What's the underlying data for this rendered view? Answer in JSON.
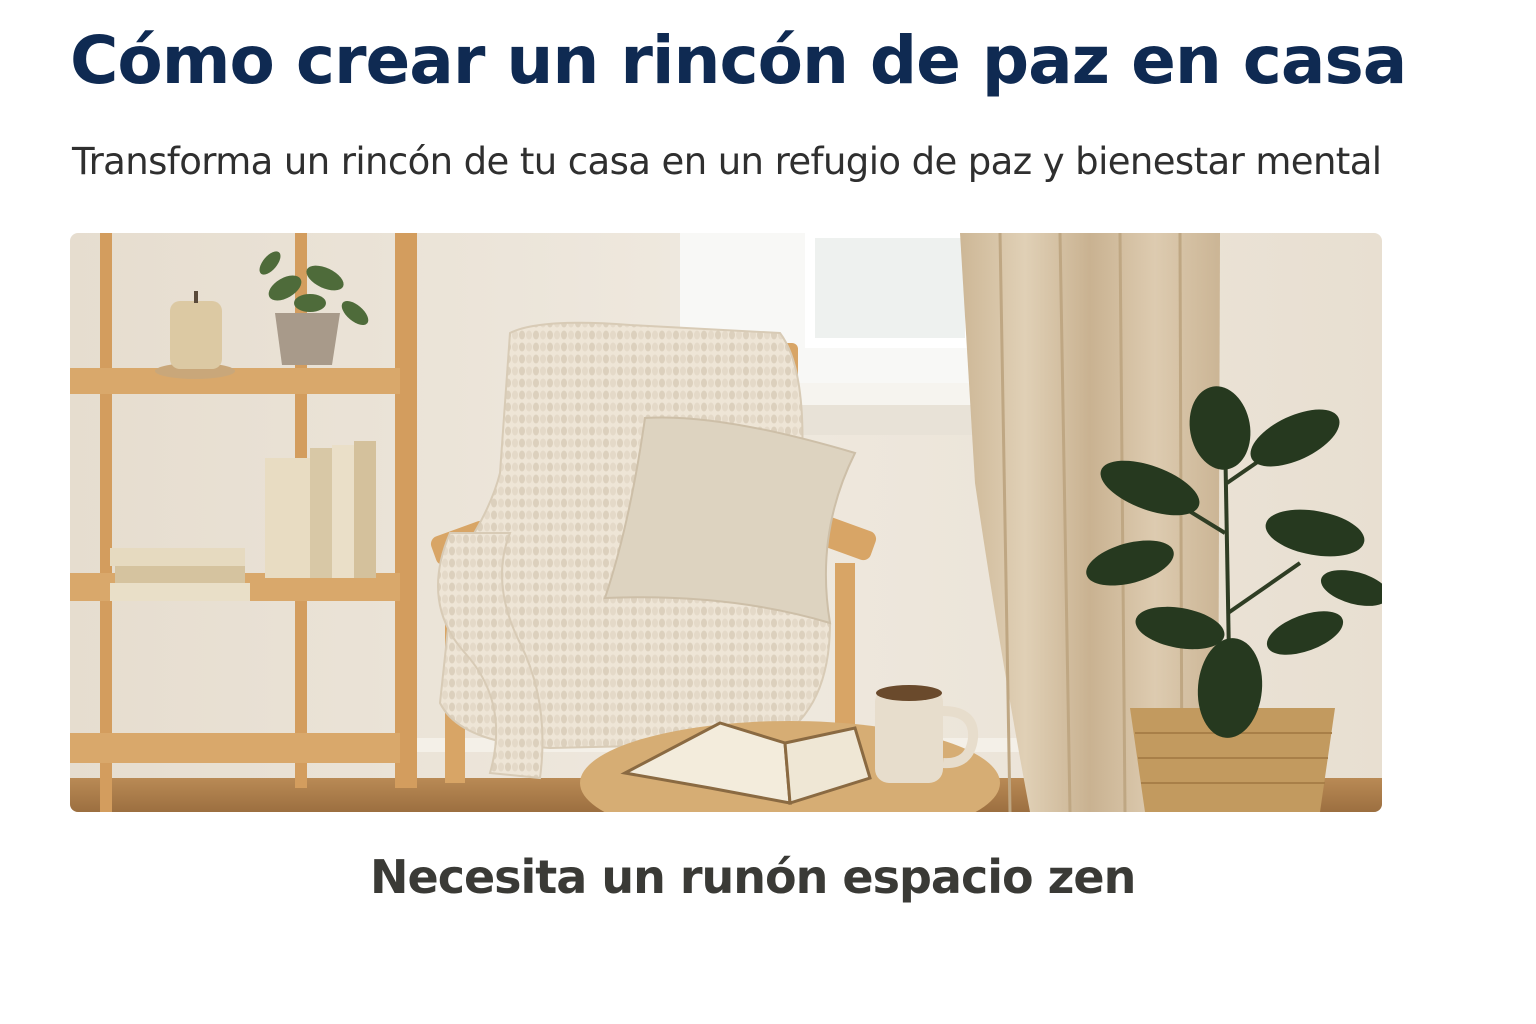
{
  "article": {
    "title": "Cómo crear un rincón de paz en casa",
    "subtitle": "Transforma un rincón de tu casa en un refugio de paz y bienestar mental",
    "caption": "Necesita un runón espacio zen"
  },
  "colors": {
    "title": "#0f2a52",
    "subtitle": "#2f2f2f",
    "caption": "#3a3a36",
    "wall": "#ebe4d8",
    "wood": "#d6a86a",
    "knit": "#efe7da",
    "curtain": "#d9c7ab",
    "leaf": "#26391f"
  }
}
